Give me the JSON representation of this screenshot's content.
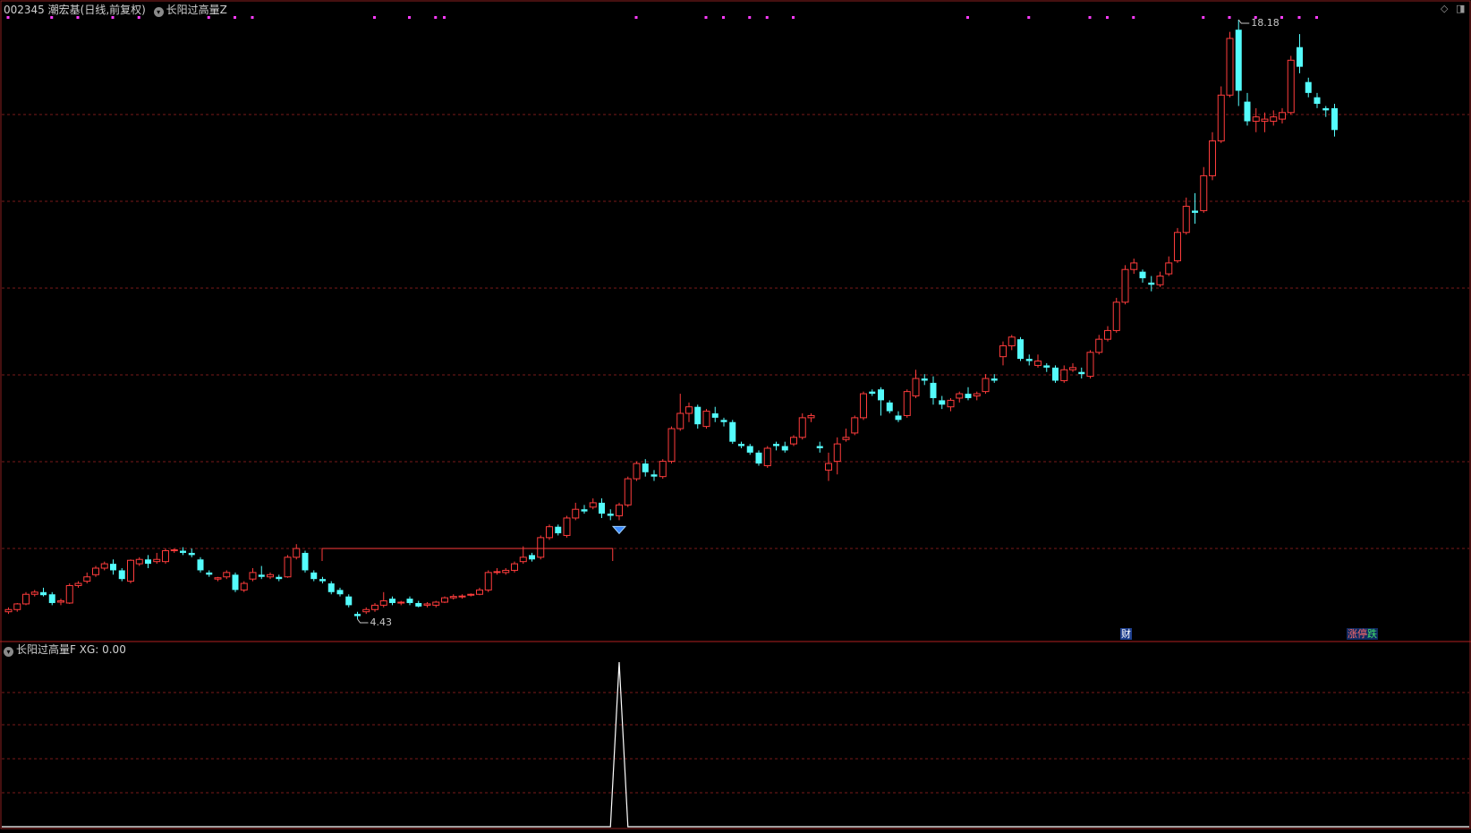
{
  "header": {
    "stock_code": "002345",
    "stock_name": "潮宏基",
    "period": "(日线,前复权)",
    "indicator_name": "长阳过高量Z"
  },
  "sub_header": {
    "indicator_name": "长阳过高量F",
    "xg_text": "XG: 0.00"
  },
  "corner_icons": [
    "diamond-icon",
    "window-icon"
  ],
  "markers": {
    "high_label": "18.18",
    "low_label": "4.43",
    "finance_badge": "财",
    "limit_badge_up": "涨停",
    "limit_badge_down": "跌"
  },
  "colors": {
    "background": "#000000",
    "up": "#ff3c3c",
    "down": "#54fcfc",
    "grid": "#7a1a1a",
    "signal_dots": "#ff3cff",
    "signal_line": "#ffffff",
    "diamond_signal": "#3d8bff"
  },
  "chart_data": {
    "type": "candlestick",
    "title": "002345 潮宏基(日线,前复权) 长阳过高量Z",
    "low_label": 4.43,
    "high_label": 18.18,
    "ohlc": [
      [
        4.6,
        4.7,
        4.55,
        4.65
      ],
      [
        4.65,
        4.8,
        4.6,
        4.78
      ],
      [
        4.78,
        5.05,
        4.75,
        5.0
      ],
      [
        5.0,
        5.1,
        4.95,
        5.05
      ],
      [
        5.05,
        5.15,
        4.95,
        4.98
      ],
      [
        5.0,
        5.05,
        4.75,
        4.8
      ],
      [
        4.82,
        4.9,
        4.75,
        4.85
      ],
      [
        4.8,
        5.25,
        4.78,
        5.2
      ],
      [
        5.2,
        5.3,
        5.15,
        5.25
      ],
      [
        5.3,
        5.5,
        5.25,
        5.4
      ],
      [
        5.45,
        5.65,
        5.4,
        5.6
      ],
      [
        5.6,
        5.75,
        5.55,
        5.7
      ],
      [
        5.7,
        5.8,
        5.45,
        5.55
      ],
      [
        5.55,
        5.6,
        5.3,
        5.35
      ],
      [
        5.3,
        5.8,
        5.25,
        5.78
      ],
      [
        5.7,
        5.85,
        5.65,
        5.8
      ],
      [
        5.8,
        5.9,
        5.6,
        5.7
      ],
      [
        5.75,
        5.95,
        5.7,
        5.8
      ],
      [
        5.75,
        6.05,
        5.7,
        6.0
      ],
      [
        6.0,
        6.05,
        5.95,
        6.02
      ],
      [
        6.0,
        6.08,
        5.9,
        5.95
      ],
      [
        5.95,
        6.05,
        5.85,
        5.9
      ],
      [
        5.8,
        5.85,
        5.5,
        5.55
      ],
      [
        5.5,
        5.55,
        5.4,
        5.45
      ],
      [
        5.35,
        5.4,
        5.3,
        5.38
      ],
      [
        5.4,
        5.55,
        5.35,
        5.5
      ],
      [
        5.45,
        5.5,
        5.05,
        5.1
      ],
      [
        5.1,
        5.3,
        5.05,
        5.25
      ],
      [
        5.35,
        5.6,
        5.3,
        5.5
      ],
      [
        5.45,
        5.65,
        5.35,
        5.4
      ],
      [
        5.4,
        5.5,
        5.35,
        5.45
      ],
      [
        5.4,
        5.45,
        5.3,
        5.35
      ],
      [
        5.4,
        5.9,
        5.38,
        5.85
      ],
      [
        5.85,
        6.15,
        5.8,
        6.05
      ],
      [
        5.95,
        6.0,
        5.5,
        5.55
      ],
      [
        5.5,
        5.55,
        5.3,
        5.35
      ],
      [
        5.35,
        5.4,
        5.25,
        5.3
      ],
      [
        5.25,
        5.3,
        5.0,
        5.05
      ],
      [
        5.1,
        5.15,
        4.95,
        5.0
      ],
      [
        4.95,
        5.0,
        4.7,
        4.75
      ],
      [
        4.55,
        4.6,
        4.43,
        4.5
      ],
      [
        4.6,
        4.7,
        4.55,
        4.65
      ],
      [
        4.65,
        4.8,
        4.6,
        4.75
      ],
      [
        4.75,
        5.05,
        4.7,
        4.85
      ],
      [
        4.9,
        4.95,
        4.75,
        4.8
      ],
      [
        4.8,
        4.85,
        4.75,
        4.82
      ],
      [
        4.9,
        4.95,
        4.75,
        4.8
      ],
      [
        4.8,
        4.85,
        4.7,
        4.72
      ],
      [
        4.75,
        4.82,
        4.7,
        4.78
      ],
      [
        4.75,
        4.85,
        4.7,
        4.82
      ],
      [
        4.82,
        4.95,
        4.8,
        4.92
      ],
      [
        4.92,
        5.0,
        4.88,
        4.95
      ],
      [
        4.95,
        5.0,
        4.9,
        4.96
      ],
      [
        4.98,
        5.02,
        4.95,
        5.0
      ],
      [
        5.0,
        5.15,
        4.98,
        5.1
      ],
      [
        5.1,
        5.55,
        5.05,
        5.5
      ],
      [
        5.5,
        5.6,
        5.45,
        5.52
      ],
      [
        5.5,
        5.6,
        5.45,
        5.55
      ],
      [
        5.55,
        5.75,
        5.5,
        5.7
      ],
      [
        5.75,
        6.1,
        5.7,
        5.85
      ],
      [
        5.9,
        5.95,
        5.75,
        5.8
      ],
      [
        5.85,
        6.35,
        5.8,
        6.3
      ],
      [
        6.3,
        6.6,
        6.25,
        6.55
      ],
      [
        6.55,
        6.6,
        6.35,
        6.4
      ],
      [
        6.35,
        6.8,
        6.3,
        6.75
      ],
      [
        6.75,
        7.1,
        6.7,
        6.95
      ],
      [
        6.95,
        7.05,
        6.85,
        6.9
      ],
      [
        7.0,
        7.2,
        6.95,
        7.1
      ],
      [
        7.1,
        7.2,
        6.75,
        6.85
      ],
      [
        6.85,
        6.95,
        6.7,
        6.8
      ],
      [
        6.8,
        7.1,
        6.7,
        7.05
      ],
      [
        7.05,
        7.7,
        7.0,
        7.65
      ],
      [
        7.65,
        8.05,
        7.6,
        8.0
      ],
      [
        8.0,
        8.1,
        7.7,
        7.8
      ],
      [
        7.75,
        7.85,
        7.6,
        7.7
      ],
      [
        7.7,
        8.1,
        7.65,
        8.05
      ],
      [
        8.05,
        8.85,
        8.0,
        8.8
      ],
      [
        8.8,
        9.6,
        8.75,
        9.15
      ],
      [
        9.15,
        9.4,
        8.95,
        9.3
      ],
      [
        9.3,
        9.35,
        8.8,
        8.9
      ],
      [
        8.85,
        9.25,
        8.8,
        9.2
      ],
      [
        9.15,
        9.3,
        8.95,
        9.05
      ],
      [
        9.0,
        9.05,
        8.85,
        8.95
      ],
      [
        8.95,
        9.0,
        8.45,
        8.5
      ],
      [
        8.45,
        8.5,
        8.35,
        8.4
      ],
      [
        8.4,
        8.45,
        8.2,
        8.25
      ],
      [
        8.25,
        8.3,
        7.95,
        8.0
      ],
      [
        7.95,
        8.4,
        7.9,
        8.35
      ],
      [
        8.45,
        8.5,
        8.3,
        8.4
      ],
      [
        8.4,
        8.5,
        8.25,
        8.3
      ],
      [
        8.45,
        8.65,
        8.4,
        8.6
      ],
      [
        8.6,
        9.15,
        8.55,
        9.05
      ],
      [
        9.05,
        9.15,
        8.95,
        9.1
      ],
      [
        8.4,
        8.5,
        8.25,
        8.35
      ],
      [
        7.85,
        8.25,
        7.6,
        8.0
      ],
      [
        8.05,
        8.6,
        7.75,
        8.45
      ],
      [
        8.55,
        8.8,
        8.5,
        8.6
      ],
      [
        8.7,
        9.1,
        8.65,
        9.05
      ],
      [
        9.05,
        9.65,
        9.0,
        9.6
      ],
      [
        9.65,
        9.7,
        9.55,
        9.6
      ],
      [
        9.7,
        9.75,
        9.1,
        9.45
      ],
      [
        9.4,
        9.45,
        9.15,
        9.2
      ],
      [
        9.1,
        9.2,
        8.95,
        9.0
      ],
      [
        9.1,
        9.7,
        9.05,
        9.65
      ],
      [
        9.55,
        10.15,
        9.5,
        9.95
      ],
      [
        9.95,
        10.05,
        9.8,
        9.9
      ],
      [
        9.85,
        10.0,
        9.35,
        9.5
      ],
      [
        9.45,
        9.55,
        9.25,
        9.35
      ],
      [
        9.3,
        9.5,
        9.2,
        9.45
      ],
      [
        9.5,
        9.65,
        9.4,
        9.6
      ],
      [
        9.6,
        9.75,
        9.45,
        9.5
      ],
      [
        9.55,
        9.65,
        9.45,
        9.6
      ],
      [
        9.65,
        10.05,
        9.6,
        9.95
      ],
      [
        9.95,
        10.05,
        9.85,
        9.9
      ],
      [
        10.45,
        10.8,
        10.25,
        10.7
      ],
      [
        10.7,
        10.95,
        10.6,
        10.9
      ],
      [
        10.85,
        10.9,
        10.35,
        10.4
      ],
      [
        10.4,
        10.5,
        10.25,
        10.35
      ],
      [
        10.25,
        10.5,
        10.2,
        10.35
      ],
      [
        10.25,
        10.3,
        10.1,
        10.2
      ],
      [
        10.2,
        10.25,
        9.85,
        9.9
      ],
      [
        9.9,
        10.25,
        9.85,
        10.15
      ],
      [
        10.15,
        10.3,
        10.1,
        10.2
      ],
      [
        10.1,
        10.2,
        9.95,
        10.05
      ],
      [
        10.0,
        10.6,
        9.95,
        10.55
      ],
      [
        10.55,
        10.95,
        10.5,
        10.85
      ],
      [
        10.85,
        11.15,
        10.8,
        11.05
      ],
      [
        11.05,
        11.8,
        11.0,
        11.7
      ],
      [
        11.7,
        12.55,
        11.65,
        12.45
      ],
      [
        12.45,
        12.7,
        12.35,
        12.6
      ],
      [
        12.4,
        12.45,
        12.15,
        12.25
      ],
      [
        12.15,
        12.3,
        11.95,
        12.1
      ],
      [
        12.1,
        12.4,
        12.05,
        12.3
      ],
      [
        12.35,
        12.75,
        12.3,
        12.6
      ],
      [
        12.65,
        13.4,
        12.6,
        13.3
      ],
      [
        13.3,
        14.1,
        13.25,
        13.9
      ],
      [
        13.8,
        14.2,
        13.5,
        13.75
      ],
      [
        13.8,
        14.8,
        13.75,
        14.6
      ],
      [
        14.6,
        15.6,
        14.5,
        15.4
      ],
      [
        15.4,
        16.65,
        15.35,
        16.45
      ],
      [
        16.45,
        17.9,
        16.4,
        17.75
      ],
      [
        17.95,
        18.18,
        16.2,
        16.55
      ],
      [
        16.3,
        16.5,
        15.75,
        15.85
      ],
      [
        15.85,
        16.15,
        15.6,
        15.95
      ],
      [
        15.85,
        16.05,
        15.6,
        15.9
      ],
      [
        15.85,
        16.1,
        15.75,
        15.95
      ],
      [
        15.9,
        16.15,
        15.8,
        16.05
      ],
      [
        16.05,
        17.35,
        16.0,
        17.25
      ],
      [
        17.55,
        17.85,
        16.95,
        17.1
      ],
      [
        16.75,
        16.85,
        16.4,
        16.5
      ],
      [
        16.4,
        16.5,
        16.15,
        16.25
      ],
      [
        16.15,
        16.2,
        15.95,
        16.1
      ],
      [
        16.15,
        16.25,
        15.5,
        15.65
      ]
    ],
    "sub_indicator": {
      "name": "长阳过高量F",
      "XG": 0.0,
      "signal_bar_index": 70,
      "values_note": "XG is 0 everywhere except 1 at the signal bar"
    }
  }
}
